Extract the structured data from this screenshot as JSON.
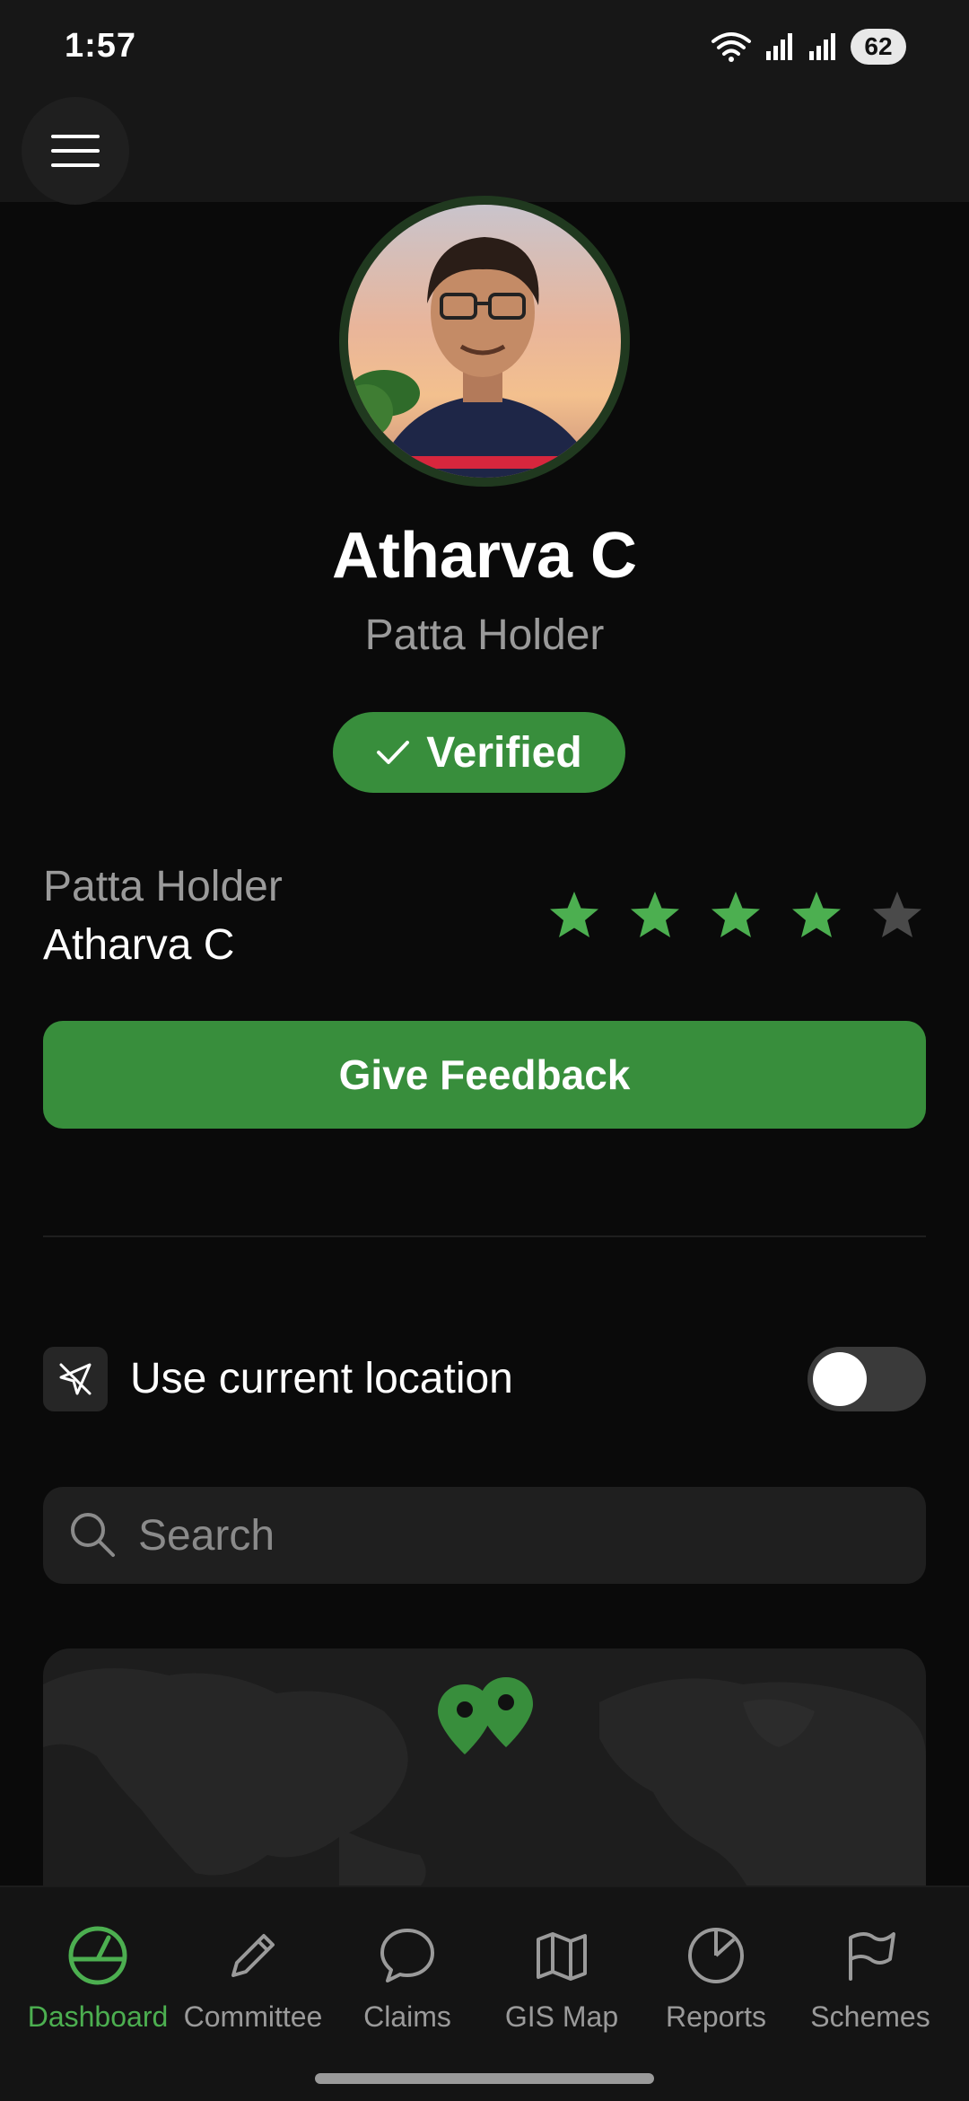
{
  "status_bar": {
    "time": "1:57",
    "battery": "62"
  },
  "profile": {
    "name": "Atharva C",
    "role": "Patta Holder",
    "verified_label": "Verified"
  },
  "holder": {
    "title": "Patta Holder",
    "name": "Atharva C",
    "rating": 4,
    "rating_max": 5
  },
  "feedback_button": "Give Feedback",
  "location": {
    "label": "Use current location",
    "enabled": false
  },
  "search": {
    "placeholder": "Search"
  },
  "nav": {
    "items": [
      {
        "label": "Dashboard",
        "icon": "dashboard-gauge-icon",
        "active": true
      },
      {
        "label": "Committee",
        "icon": "pencil-icon",
        "active": false
      },
      {
        "label": "Claims",
        "icon": "chat-bubble-icon",
        "active": false
      },
      {
        "label": "GIS Map",
        "icon": "map-icon",
        "active": false
      },
      {
        "label": "Reports",
        "icon": "pie-chart-icon",
        "active": false
      },
      {
        "label": "Schemes",
        "icon": "flag-icon",
        "active": false
      }
    ]
  },
  "colors": {
    "accent": "#388e3c",
    "accent_light": "#4caf50",
    "background": "#0a0a0a",
    "star_inactive": "#4a4a4a"
  }
}
